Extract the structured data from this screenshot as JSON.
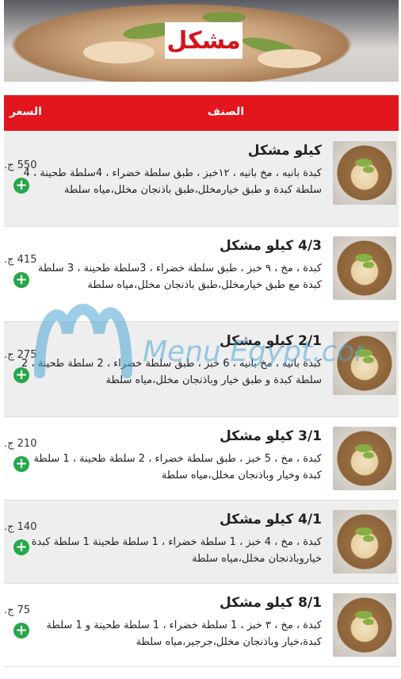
{
  "banner": {
    "title": "مشكل"
  },
  "table_header": {
    "item": "الصنف",
    "price": "السعر"
  },
  "items": [
    {
      "name": "كيلو مشكل",
      "description": "كبدة بانيه ، مخ بانيه ، ١٢خبز ، طبق سلطة خضراء ، 4سلطة طحينة ، 4 سلطة كبدة و طبق خيارمخلل،طبق باذنجان مخلل،مياه سلطة",
      "price": "550 ج."
    },
    {
      "name": "4/3 كيلو مشكل",
      "description": "كبدة ، مخ ، ٩ خبز ، طبق سلطة خضراء ، 3سلطة طحينة ، 3 سلطة كبدة مع طبق خيارمخلل،طبق باذنجان مخلل،مياه سلطة",
      "price": "415 ج."
    },
    {
      "name": "2/1 كيلو مشكل",
      "description": "كبدة بانيه ، مخ بانيه ، 6 خبز ، طبق سلطة خضراء ، 2 سلطة طحينة ، 2 سلطة كبدة و طبق خيار وباذنجان مخلل،مياه سلطة",
      "price": "275 ج."
    },
    {
      "name": "3/1 كيلو مشكل",
      "description": "كبدة ، مخ ، 5 خبز ، طبق سلطة خضراء ، 2 سلطة طحينة ، 1 سلطة كبدة وخيار وباذنجان مخلل،مياه سلطة",
      "price": "210 ج."
    },
    {
      "name": "4/1 كيلو مشكل",
      "description": "كبدة ، مخ ، 4 خبز ، 1 سلطة خضراء ، 1 سلطة طحينة 1 سلطة كبدة و خياروباذنجان مخلل،مياه سلطة",
      "price": "140 ج."
    },
    {
      "name": "8/1 كيلو مشكل",
      "description": "كبدة ، مخ ، ٣ خبز ، 1 سلطة خضراء ، 1 سلطة طحينة و 1 سلطة كبدة،خيار وباذنجان مخلل،جرجير،مياه سلطة",
      "price": "75 ج."
    }
  ],
  "add_icon": "plus-circle-icon",
  "watermark": {
    "text": "Menu Egypt.com"
  },
  "colors": {
    "header": "#e3151d",
    "banner_title": "#d4151b",
    "add_button": "#25a74b",
    "odd_row": "#eeeeee",
    "watermark": "#4da7d6"
  }
}
